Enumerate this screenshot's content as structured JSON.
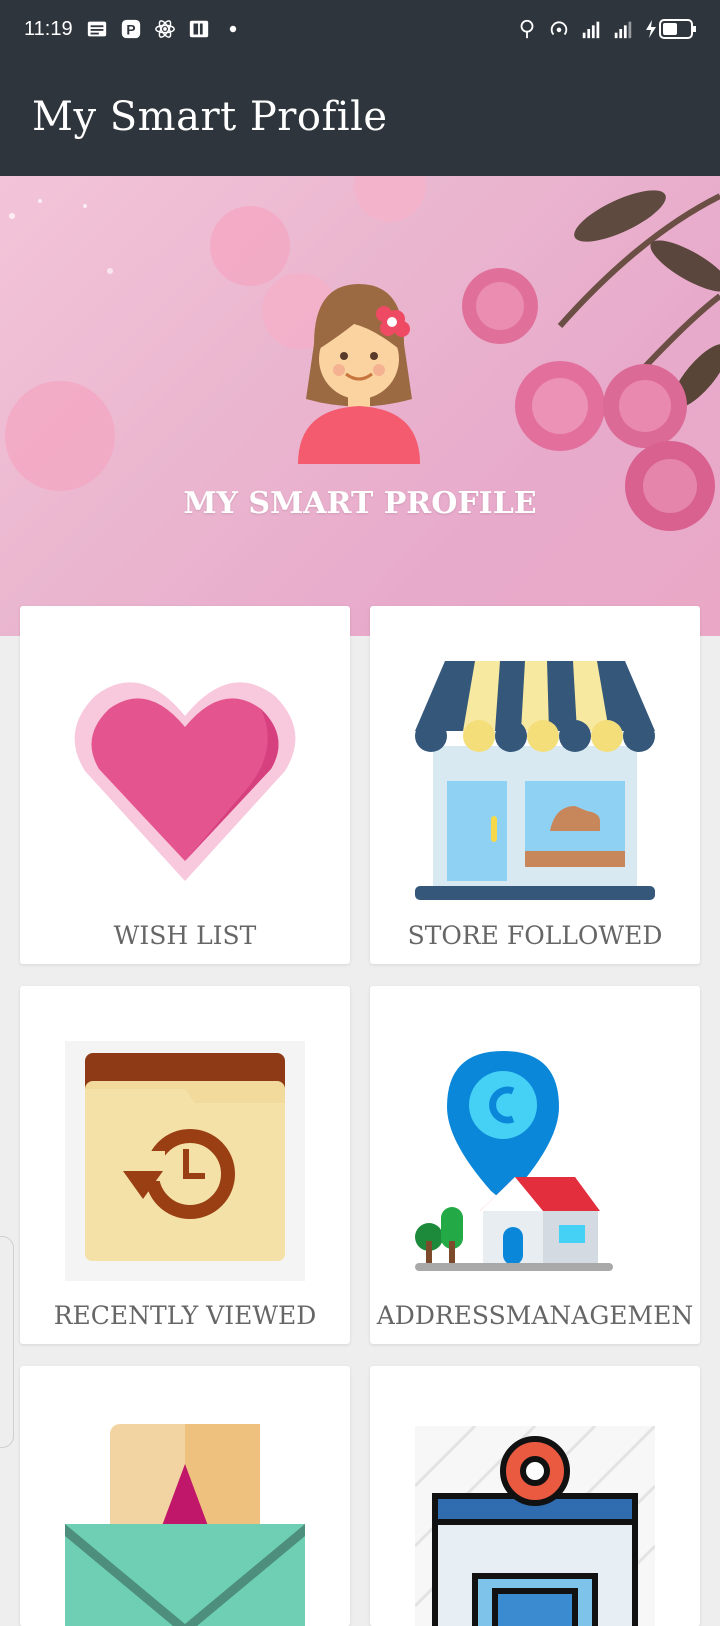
{
  "status_bar": {
    "time": "11:19"
  },
  "app_bar": {
    "title": "My Smart Profile"
  },
  "hero": {
    "title": "MY SMART PROFILE"
  },
  "menu": [
    {
      "label": "WISH LIST",
      "icon": "heart-icon"
    },
    {
      "label": "STORE FOLLOWED",
      "icon": "store-icon"
    },
    {
      "label": "RECENTLY VIEWED",
      "icon": "history-folder-icon"
    },
    {
      "label": "ADDRESSMANAGEMEN",
      "icon": "address-pin-icon"
    },
    {
      "label": "",
      "icon": "envelope-icon"
    },
    {
      "label": "",
      "icon": "store-settings-icon"
    }
  ]
}
